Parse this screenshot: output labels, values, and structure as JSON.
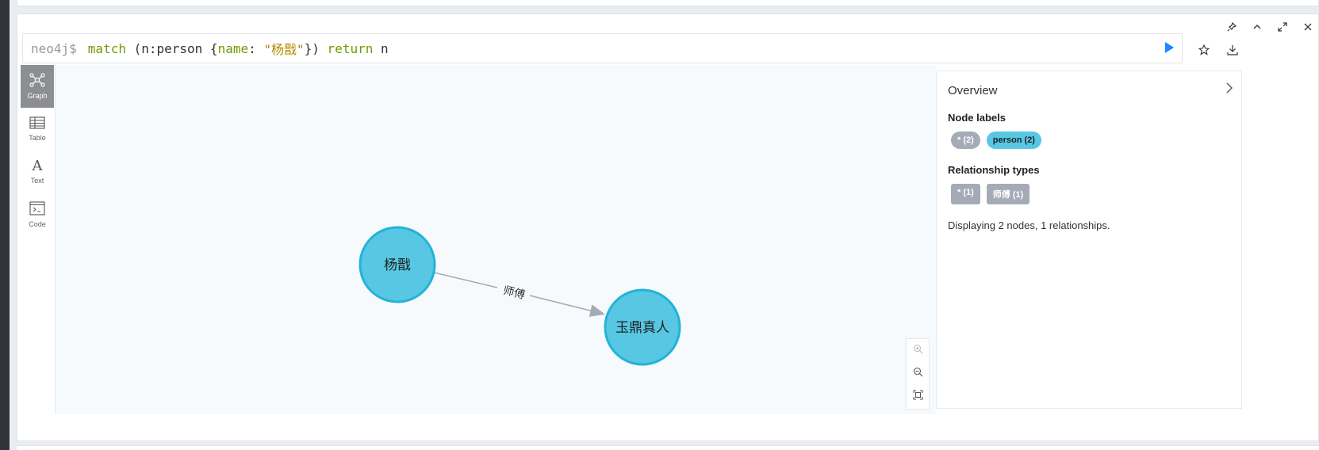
{
  "editor": {
    "prompt": "neo4j$",
    "query_parts": {
      "match": "match",
      "open": " (n:person {",
      "prop": "name",
      "colon": ": ",
      "value": "\"杨戬\"",
      "close": "}) ",
      "return": "return",
      "var": " n"
    }
  },
  "sidebar": {
    "items": [
      {
        "label": "Graph"
      },
      {
        "label": "Table"
      },
      {
        "label": "Text"
      },
      {
        "label": "Code"
      }
    ]
  },
  "graph": {
    "nodes": [
      {
        "label": "杨戬",
        "color": "#57c7e3"
      },
      {
        "label": "玉鼎真人",
        "color": "#57c7e3"
      }
    ],
    "relationship": {
      "label": "师傅"
    }
  },
  "overview": {
    "title": "Overview",
    "node_labels_heading": "Node labels",
    "node_labels": [
      "* (2)",
      "person (2)"
    ],
    "rel_types_heading": "Relationship types",
    "rel_types": [
      "* (1)",
      "师傅 (1)"
    ],
    "summary": "Displaying 2 nodes, 1 relationships."
  },
  "colors": {
    "node_fill": "#57c7e3",
    "node_border": "#23b3d7",
    "run_button": "#1a88ff",
    "keyword": "#6f9b00",
    "string": "#b58a00"
  }
}
